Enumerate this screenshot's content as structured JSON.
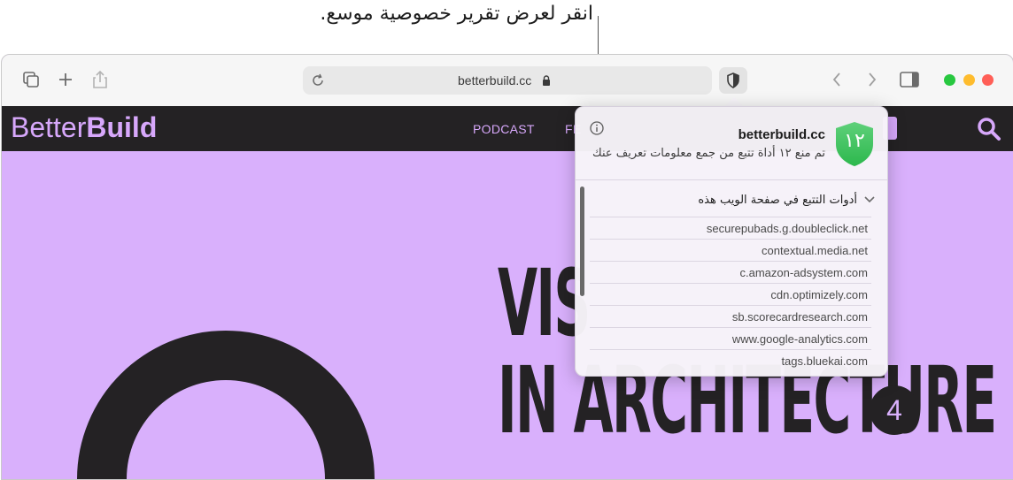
{
  "callout": {
    "text": "انقر لعرض تقرير خصوصية موسع."
  },
  "toolbar": {
    "address": "betterbuild.cc",
    "buttons": {
      "tabs_overview": "tabs-overview-icon",
      "new_tab": "plus-icon",
      "share": "share-icon",
      "reload": "reload-icon",
      "privacy_report": "shield-icon",
      "back": "chevron-left-icon",
      "forward": "chevron-right-icon",
      "sidebar": "sidebar-icon"
    },
    "traffic_lights": {
      "close": "#ff5f57",
      "minimize": "#febc2e",
      "zoom": "#28c840"
    }
  },
  "site": {
    "logo_light": "Better",
    "logo_bold": "Build",
    "nav": [
      "PODCAST",
      "FE"
    ],
    "headline": [
      "VIS",
      "IN ARCHITECTURE"
    ],
    "badge": "4",
    "colors": {
      "accent": "#d9b0fc",
      "dark": "#242224"
    }
  },
  "privacy_popover": {
    "tracker_count": "١٢",
    "site": "betterbuild.cc",
    "description": "تم منع ١٢ أداة تتبع من جمع معلومات تعريف عنك",
    "section_title": "أدوات التتبع في صفحة الويب هذه",
    "trackers": [
      "securepubads.g.doubleclick.net",
      "contextual.media.net",
      "c.amazon-adsystem.com",
      "cdn.optimizely.com",
      "sb.scorecardresearch.com",
      "www.google-analytics.com",
      "tags.bluekai.com"
    ],
    "shield_color": "#34c759"
  }
}
